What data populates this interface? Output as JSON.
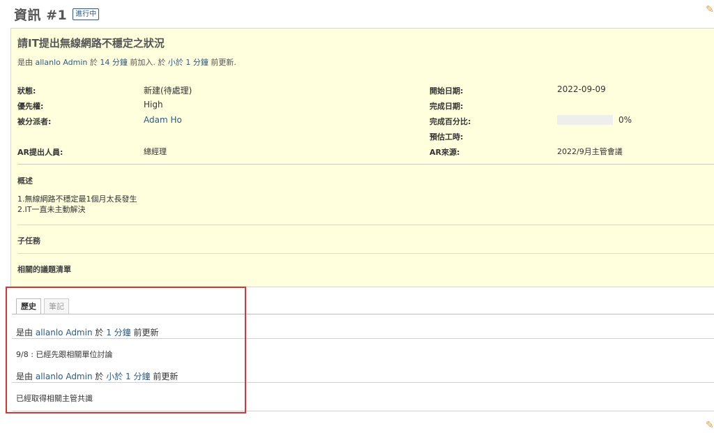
{
  "header": {
    "title": "資訊 #1",
    "status_badge": "進行中"
  },
  "issue": {
    "subject": "請IT提出無線網路不穩定之狀況",
    "author": {
      "prefix": "是由",
      "user": "allanlo Admin",
      "mid1": "於",
      "created_time": "14 分鐘",
      "mid2": "前加入. 於",
      "updated_time": "小於 1 分鐘",
      "suffix": "前更新."
    },
    "attributes_left": [
      {
        "label": "狀態:",
        "value": "新建(待處理)"
      },
      {
        "label": "優先權:",
        "value": "High"
      },
      {
        "label": "被分派者:",
        "value": "Adam Ho"
      }
    ],
    "attributes_right": [
      {
        "label": "開始日期:",
        "value": "2022-09-09"
      },
      {
        "label": "完成日期:",
        "value": ""
      },
      {
        "label": "完成百分比:",
        "value": "0%"
      },
      {
        "label": "預估工時:",
        "value": ""
      }
    ],
    "progress": {
      "percent": 0,
      "fill_color": "#90c0e8",
      "track_color": "#eeeeee"
    },
    "custom_fields": [
      {
        "label": "AR提出人員:",
        "value": "總經理"
      },
      {
        "label": "AR來源:",
        "value": "2022/9月主管會議"
      }
    ],
    "description": {
      "title": "概述",
      "lines": [
        "1.無線網路不穩定最1個月太長發生",
        "2.IT一直未主動解決"
      ]
    },
    "subtasks_title": "子任務",
    "related_title": "相關的議題清單"
  },
  "tabs": [
    {
      "label": "歷史",
      "selected": true
    },
    {
      "label": "筆記",
      "selected": false
    }
  ],
  "journal": {
    "entry1": {
      "prefix": "是由",
      "user": "allanlo Admin",
      "mid": "於",
      "time": "1 分鐘",
      "suffix": "前更新",
      "note": "9/8 : 已經先跟相關單位討論"
    },
    "entry2": {
      "prefix": "是由",
      "user": "allanlo Admin",
      "mid": "於",
      "time": "小於 1 分鐘",
      "suffix": "前更新",
      "note": "已經取得相關主管共識"
    }
  },
  "icons": {
    "edit": "pencil-icon"
  },
  "colors": {
    "box_bg": "#ffffdd",
    "link": "#2a5a8a",
    "highlight": "#e03030"
  }
}
